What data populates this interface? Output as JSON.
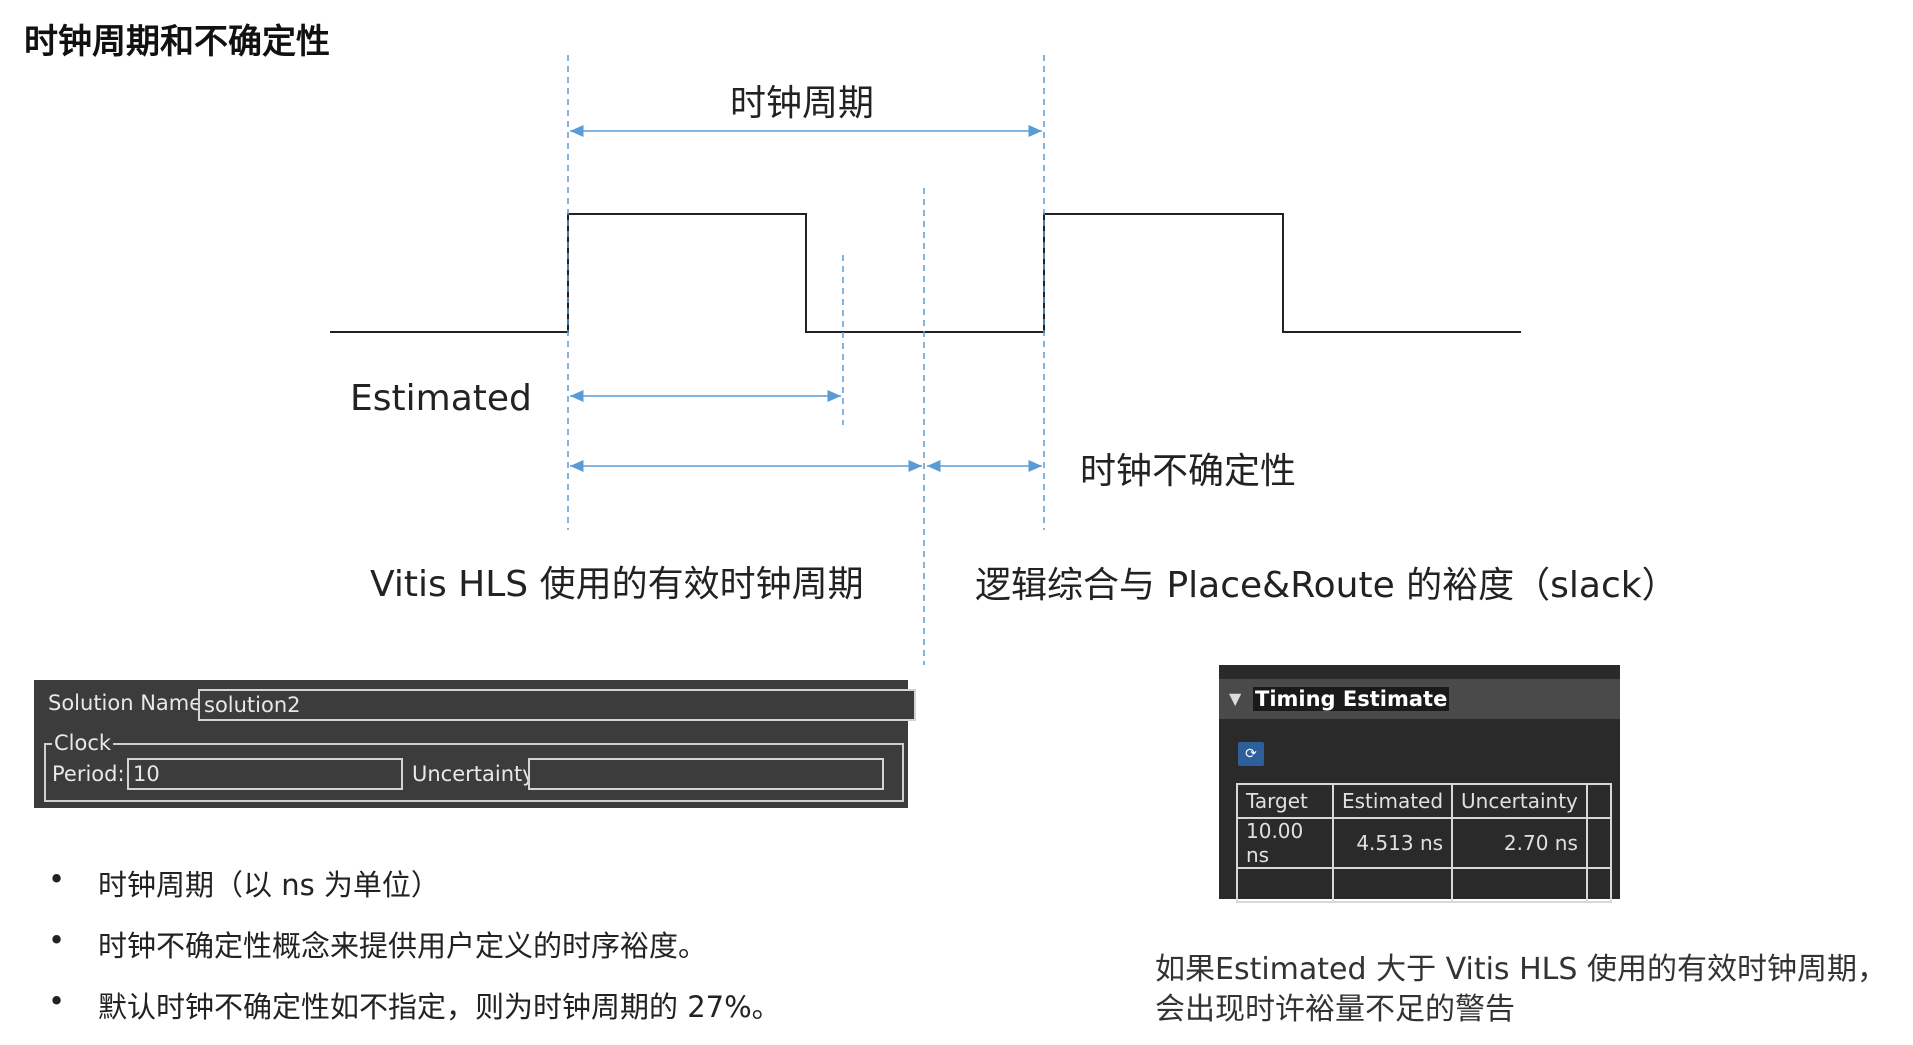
{
  "title": "时钟周期和不确定性",
  "diagram": {
    "clock_period_label": "时钟周期",
    "estimated_label": "Estimated",
    "uncertainty_label": "时钟不确定性",
    "effective_period_label": "Vitis HLS 使用的有效时钟周期",
    "slack_label": "逻辑综合与 Place&Route 的裕度（slack）",
    "colors": {
      "waveform": "#222222",
      "annotation": "#5b9bd5"
    }
  },
  "solution_panel": {
    "name_label": "Solution Name:",
    "name_value": "solution2",
    "clock_group_label": "Clock",
    "period_label": "Period:",
    "period_value": "10",
    "uncertainty_label": "Uncertainty:",
    "uncertainty_value": ""
  },
  "timing_panel": {
    "title": "Timing Estimate",
    "collapse_icon": "triangle-down-icon",
    "refresh_icon": "refresh-icon",
    "headers": [
      "Target",
      "Estimated",
      "Uncertainty"
    ],
    "row": [
      "10.00 ns",
      "4.513 ns",
      "2.70 ns"
    ]
  },
  "bullets": [
    "时钟周期（以 ns 为单位）",
    "时钟不确定性概念来提供用户定义的时序裕度。",
    "默认时钟不确定性如不指定，则为时钟周期的 27%。"
  ],
  "warning_note": {
    "line1": "如果Estimated 大于 Vitis HLS 使用的有效时钟周期，",
    "line2": "会出现时许裕量不足的警告"
  }
}
